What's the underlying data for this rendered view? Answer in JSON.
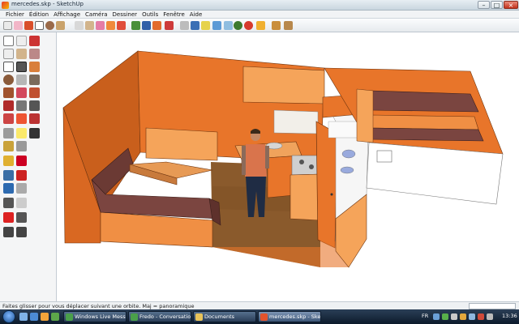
{
  "window": {
    "title": "mercedes.skp - SketchUp"
  },
  "menu": [
    "Fichier",
    "Édition",
    "Affichage",
    "Caméra",
    "Dessiner",
    "Outils",
    "Fenêtre",
    "Aide"
  ],
  "toolbar_icons": [
    "select-icon",
    "eraser-icon",
    "pencil-icon",
    "rectangle-icon",
    "circle-icon",
    "arc-icon",
    "make-component-icon",
    "paint-bucket-icon",
    "push-pull-icon",
    "follow-me-icon",
    "move-icon",
    "rotate-icon",
    "offset-icon",
    "scale-icon",
    "tape-measure-icon",
    "dimension-icon",
    "protractor-icon",
    "text-icon",
    "orbit-icon",
    "pan-icon",
    "zoom-icon",
    "zoom-window-icon",
    "zoom-extents-icon",
    "previous-view-icon",
    "get-models-icon",
    "share-model-icon",
    "component-icon",
    "extension-icon",
    "warehouse-icon"
  ],
  "status": {
    "message": "Faites glisser pour vous déplacer suivant une orbite.  Maj = panoramique"
  },
  "taskbar": {
    "tasks": [
      "Windows Live Mess...",
      "Fredo - Conversation",
      "Documents",
      "mercedes.skp - Sket..."
    ],
    "lang": "FR",
    "time": "13:36"
  },
  "colors": {
    "wall_orange": "#e8752a",
    "wall_dark": "#c95f1c",
    "floor_wood": "#8a5a2c",
    "bench_brown": "#6b3a34",
    "cabinet_light": "#f5a45a",
    "white": "#ffffff"
  }
}
